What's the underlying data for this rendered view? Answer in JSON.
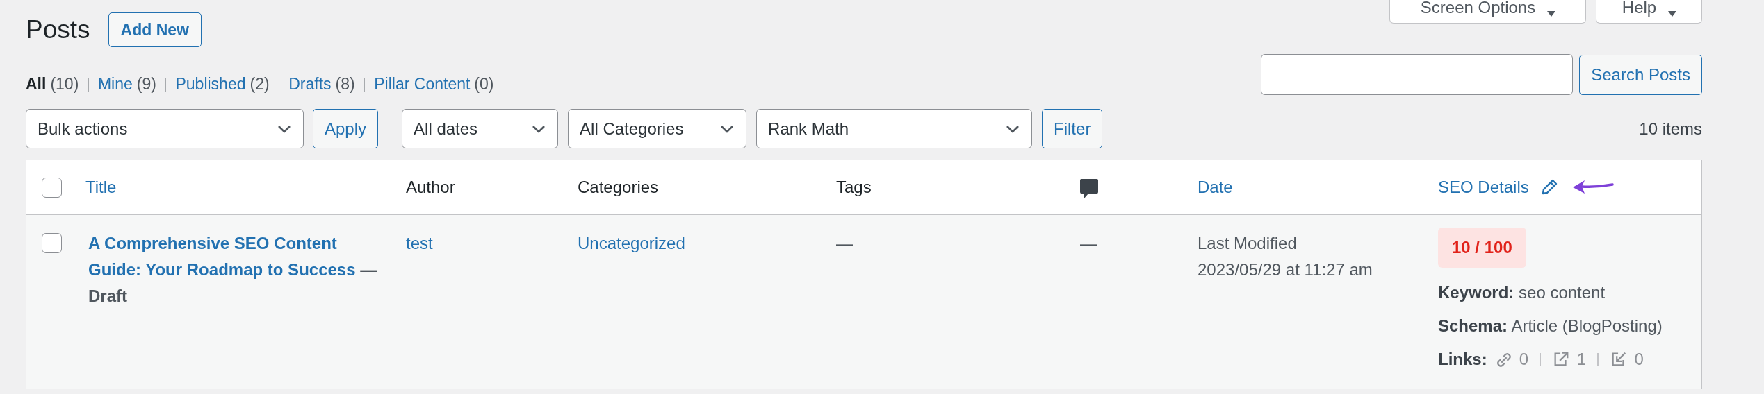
{
  "page_title": "Posts",
  "add_new": "Add New",
  "screen_meta": [
    {
      "label": "Screen Options"
    },
    {
      "label": "Help"
    }
  ],
  "views": [
    {
      "label": "All",
      "count": "(10)",
      "selected": true
    },
    {
      "label": "Mine",
      "count": "(9)",
      "selected": false
    },
    {
      "label": "Published",
      "count": "(2)",
      "selected": false
    },
    {
      "label": "Drafts",
      "count": "(8)",
      "selected": false
    },
    {
      "label": "Pillar Content",
      "count": "(0)",
      "selected": false
    }
  ],
  "search": {
    "button": "Search Posts"
  },
  "bulk": {
    "select": "Bulk actions",
    "apply": "Apply"
  },
  "filters": [
    {
      "value": "All dates"
    },
    {
      "value": "All Categories"
    },
    {
      "value": "Rank Math"
    }
  ],
  "filter_button": "Filter",
  "items_count": "10 items",
  "table": {
    "select_all": {
      "checked": false
    },
    "columns": [
      {
        "kind": "sortable",
        "label": "Title"
      },
      {
        "kind": "plain",
        "label": "Author"
      },
      {
        "kind": "plain",
        "label": "Categories"
      },
      {
        "kind": "plain",
        "label": "Tags"
      },
      {
        "kind": "comments"
      },
      {
        "kind": "sortable",
        "label": "Date"
      },
      {
        "kind": "seo",
        "label": "SEO Details"
      }
    ],
    "rows": [
      {
        "checked": false,
        "title": "A Comprehensive SEO Content Guide: Your Roadmap to Success",
        "post_state": "— Draft",
        "author": "test",
        "categories": "Uncategorized",
        "tags": "—",
        "comments": "—",
        "date_label": "Last Modified",
        "date": "2023/05/29 at 11:27 am",
        "seo": {
          "score": "10 / 100",
          "keyword": "**Keyword:** seo content",
          "schema": "**Schema:** Article (BlogPosting)",
          "links_label": "Links:",
          "links": [
            {
              "kind": "internal",
              "count": "0"
            },
            {
              "kind": "external",
              "count": "1"
            },
            {
              "kind": "incoming",
              "count": "0"
            }
          ]
        }
      }
    ]
  }
}
